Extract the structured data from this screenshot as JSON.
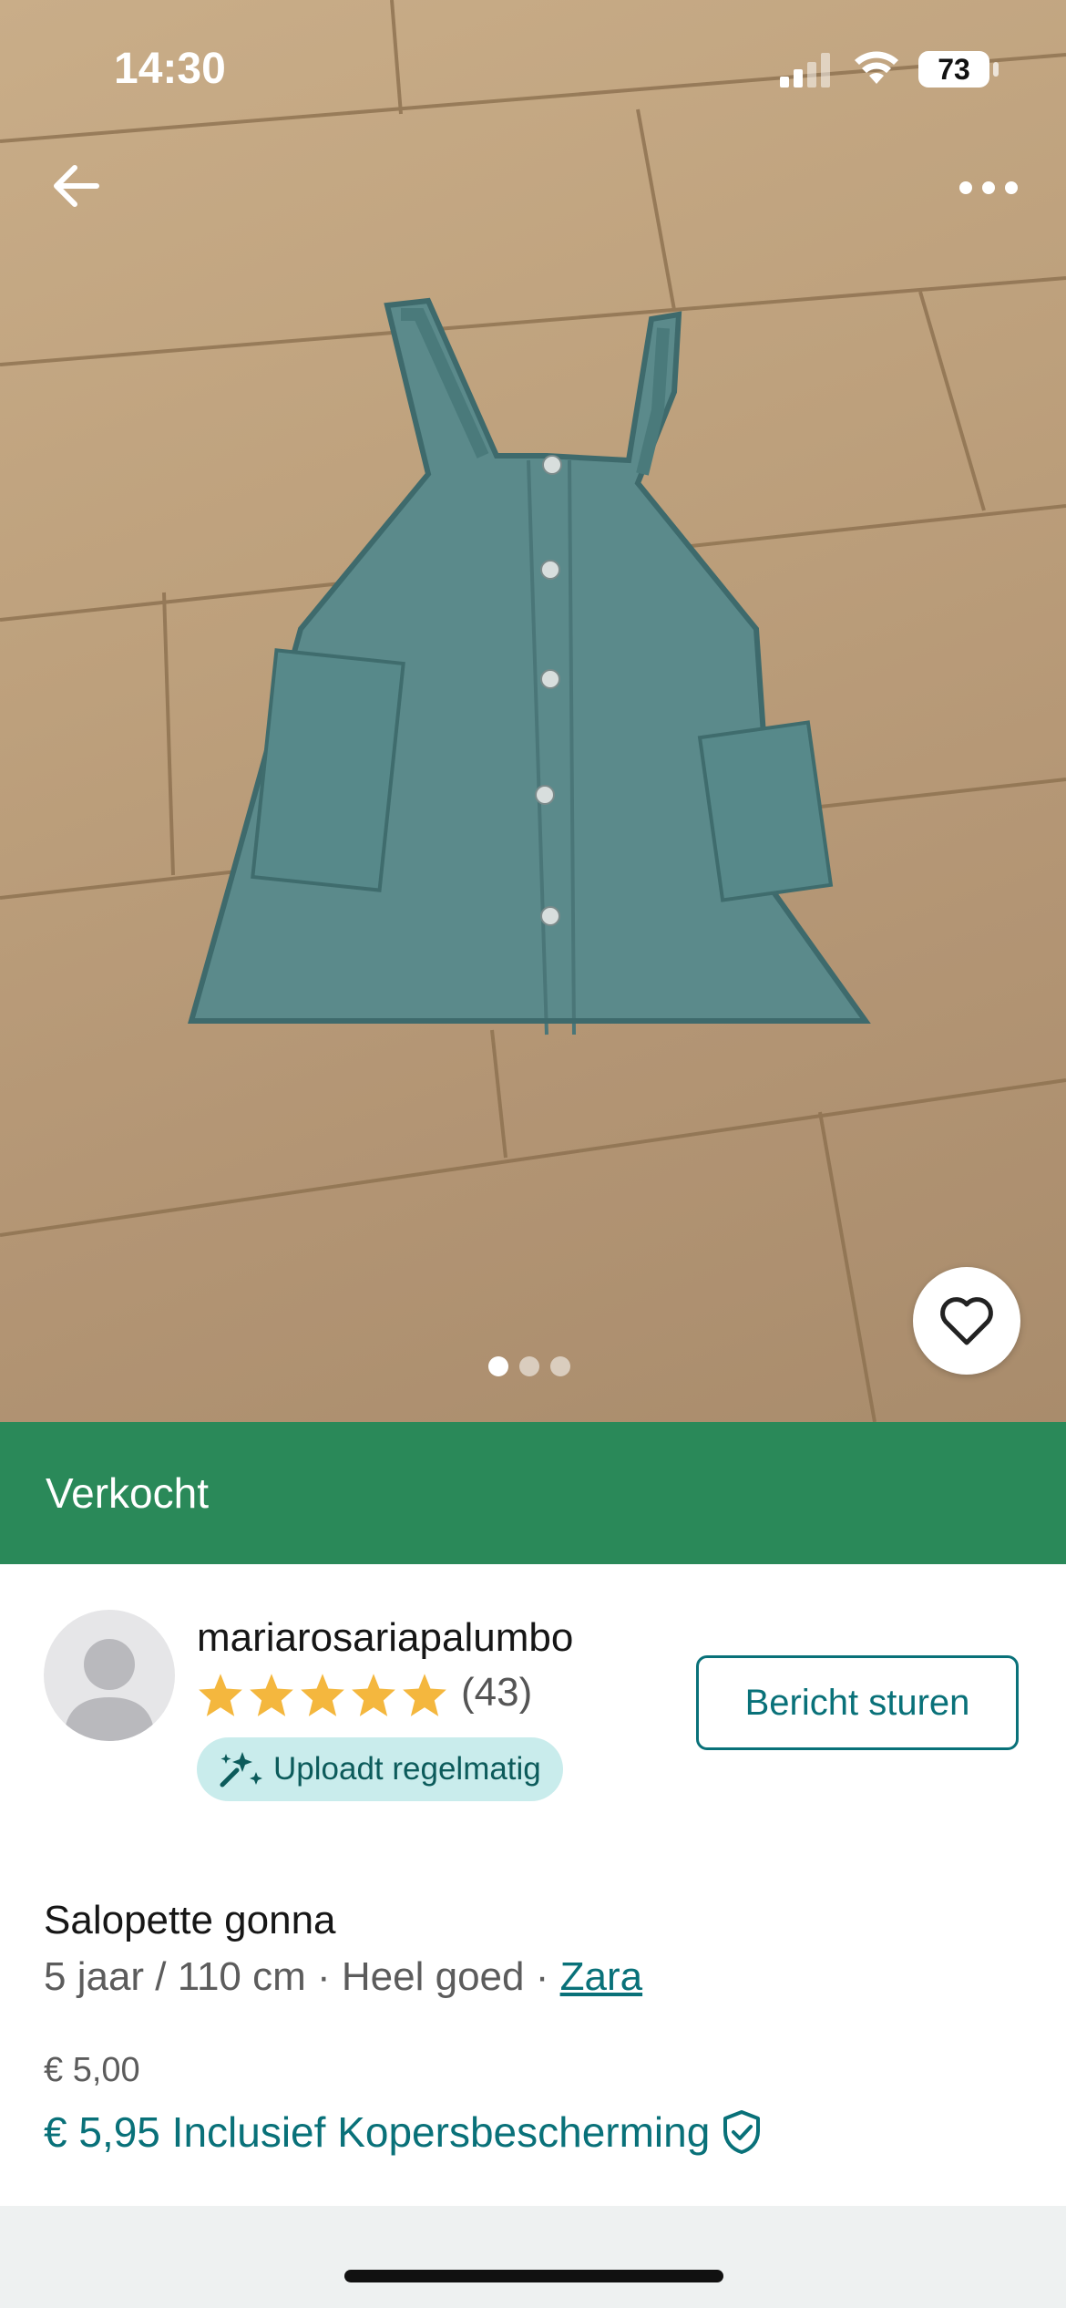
{
  "status_bar": {
    "time": "14:30",
    "battery": "73"
  },
  "header": {
    "back_icon": "arrow-left-icon",
    "more_icon": "more-horizontal-icon"
  },
  "photo": {
    "image": "denim pinafore dress on wooden floor",
    "page_count": 3,
    "active_page": 1,
    "favorite_icon": "heart-icon"
  },
  "banner": {
    "label": "Verkocht",
    "color": "#2a8959"
  },
  "seller": {
    "username": "mariarosariapalumbo",
    "rating_stars": 5,
    "rating_count": "(43)",
    "badge_label": "Uploadt regelmatig",
    "badge_icon": "upload-sparkle-icon",
    "message_button": "Bericht sturen"
  },
  "item": {
    "title": "Salopette gonna",
    "size": "5 jaar / 110 cm",
    "separator": " · ",
    "condition": "Heel goed",
    "brand": "Zara",
    "price": "€ 5,00",
    "total_price": "€ 5,95 Inclusief Kopersbescherming",
    "protection_icon": "shield-check-icon"
  },
  "colors": {
    "accent": "#097179",
    "star": "#f4b73e"
  }
}
